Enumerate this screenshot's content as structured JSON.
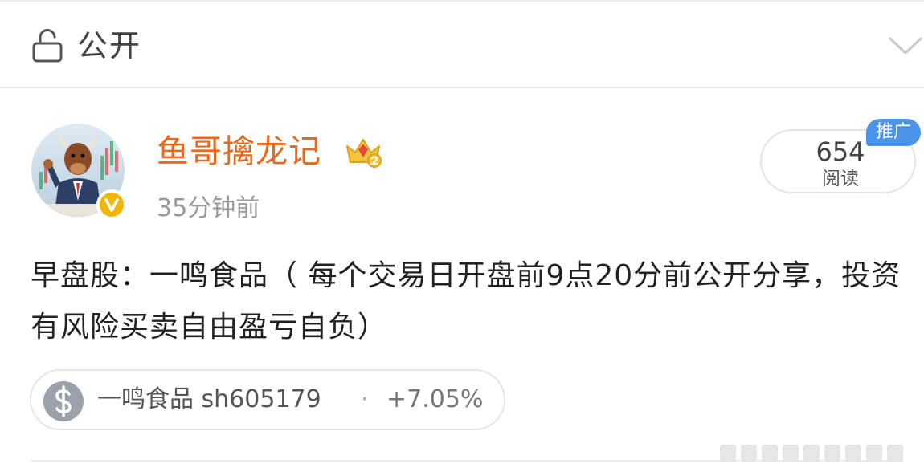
{
  "visibility": {
    "label": "公开",
    "icon": "lock-open-icon"
  },
  "author": {
    "name": "鱼哥擒龙记",
    "avatar_icon": "bull-businessman-avatar",
    "verified_icon": "verified-v-badge-icon",
    "crown_icon": "crown-level-icon",
    "time": "35分钟前"
  },
  "reads": {
    "count": "654",
    "label": "阅读",
    "promo_tag": "推广"
  },
  "post": {
    "text": "早盘股：一鸣食品（ 每个交易日开盘前9点20分前公开分享，投资有风险买卖自由盈亏自负）"
  },
  "stock": {
    "name_code": "一鸣食品 sh605179",
    "separator": "·",
    "change": "+7.05%"
  },
  "colors": {
    "author_name": "#e8691b",
    "promo_tag_bg": "#4c93ea",
    "verified_badge": "#f2b705"
  }
}
